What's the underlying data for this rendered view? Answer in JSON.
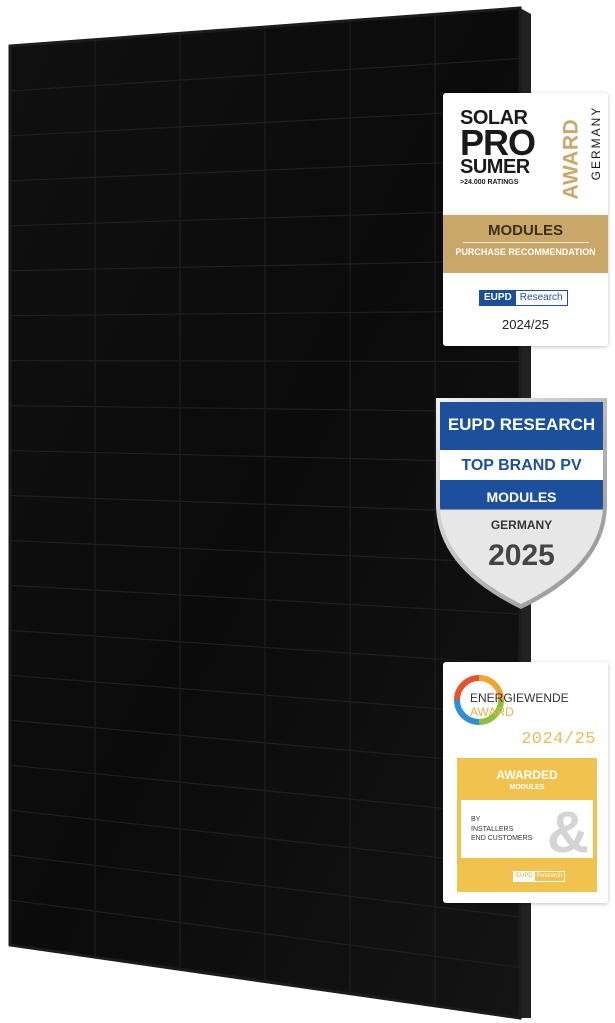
{
  "colors": {
    "panel": "#0d0d0d",
    "gold": "#c8a769",
    "eupd_blue": "#1a4f9b",
    "energiewende_yellow": "#f2c24f"
  },
  "badge_prosumer": {
    "line1": "SOLAR",
    "line2": "PRO",
    "line3": "SUMER",
    "award": "AWARD",
    "country": "GERMANY",
    "ratings": ">24.000 RATINGS",
    "category": "MODULES",
    "subtitle": "PURCHASE RECOMMENDATION",
    "logo_left": "EUPD",
    "logo_right": "Research",
    "year": "2024/25"
  },
  "badge_topbrand": {
    "line1": "EUPD RESEARCH",
    "line2": "TOP BRAND PV",
    "line3": "MODULES",
    "line4": "GERMANY",
    "year": "2025"
  },
  "badge_energiewende": {
    "name": "ENERGIEWENDE",
    "name_sub": "AWARD",
    "year": "2024/25",
    "status": "AWARDED",
    "category": "MODULES",
    "by": "BY",
    "by_line1": "INSTALLERS",
    "by_line2": "END CUSTOMERS",
    "amp": "&",
    "logo_left": "EUPD",
    "logo_right": "Research"
  }
}
